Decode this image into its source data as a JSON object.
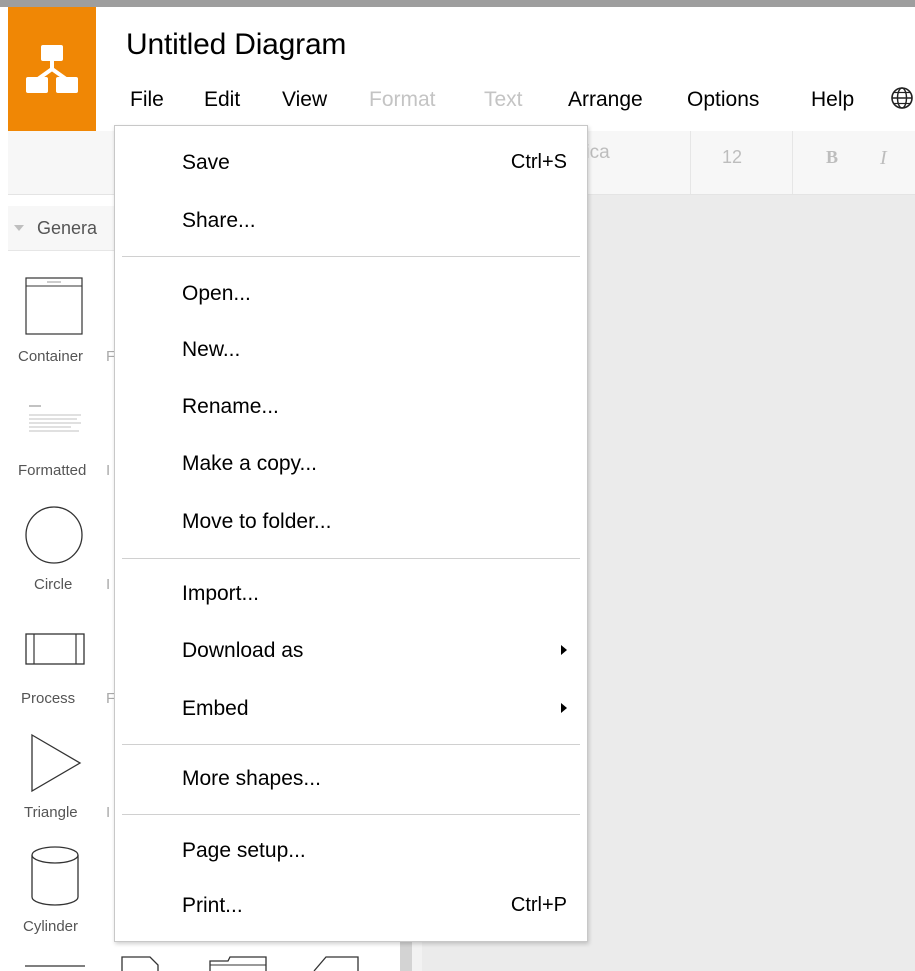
{
  "app": {
    "title": "Untitled Diagram",
    "brand_color": "#f08705",
    "icon": "drawio-logo-icon"
  },
  "menubar": {
    "items": [
      {
        "label": "File",
        "enabled": true
      },
      {
        "label": "Edit",
        "enabled": true
      },
      {
        "label": "View",
        "enabled": true
      },
      {
        "label": "Format",
        "enabled": false
      },
      {
        "label": "Text",
        "enabled": false
      },
      {
        "label": "Arrange",
        "enabled": true
      },
      {
        "label": "Options",
        "enabled": true
      },
      {
        "label": "Help",
        "enabled": true
      }
    ],
    "language_icon": "globe-icon"
  },
  "toolbar": {
    "font_name": "vetica",
    "font_size": "12",
    "bold_label": "B",
    "italic_label": "I"
  },
  "sidebar": {
    "section_title": "Genera",
    "shapes": [
      {
        "label": "Container",
        "icon": "container-icon"
      },
      {
        "label": "Formatted",
        "icon": "formatted-text-icon"
      },
      {
        "label": "Circle",
        "icon": "circle-icon"
      },
      {
        "label": "Process",
        "icon": "process-icon"
      },
      {
        "label": "Triangle",
        "icon": "triangle-icon"
      },
      {
        "label": "Cylinder",
        "icon": "cylinder-icon"
      }
    ]
  },
  "file_menu": {
    "groups": [
      [
        {
          "label": "Save",
          "shortcut": "Ctrl+S"
        },
        {
          "label": "Share..."
        }
      ],
      [
        {
          "label": "Open..."
        },
        {
          "label": "New..."
        },
        {
          "label": "Rename..."
        },
        {
          "label": "Make a copy..."
        },
        {
          "label": "Move to folder..."
        }
      ],
      [
        {
          "label": "Import..."
        },
        {
          "label": "Download as",
          "submenu": true
        },
        {
          "label": "Embed",
          "submenu": true
        }
      ],
      [
        {
          "label": "More shapes..."
        }
      ],
      [
        {
          "label": "Page setup..."
        },
        {
          "label": "Print...",
          "shortcut": "Ctrl+P"
        }
      ]
    ]
  }
}
